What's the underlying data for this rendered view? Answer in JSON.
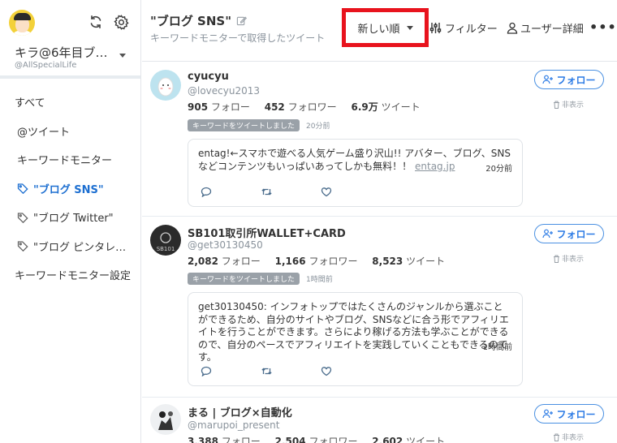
{
  "sidebar": {
    "account_name": "キラ@6年目ブ…",
    "account_handle": "@AllSpecialLife",
    "items": [
      {
        "label": "すべて"
      },
      {
        "label": "@ツイート"
      },
      {
        "label": "キーワードモニター"
      },
      {
        "label": "\"ブログ SNS\""
      },
      {
        "label": "\"ブログ Twitter\""
      },
      {
        "label": "\"ブログ ピンタレ…"
      },
      {
        "label": "キーワードモニター設定"
      }
    ]
  },
  "header": {
    "title": "\"ブログ SNS\"",
    "subtitle": "キーワードモニターで取得したツイート",
    "sort_label": "新しい順",
    "filter_label": "フィルター",
    "user_detail_label": "ユーザー詳細",
    "more_label": "•••"
  },
  "feed": [
    {
      "name": "cyucyu",
      "handle": "@lovecyu2013",
      "following": "905",
      "following_label": "フォロー",
      "followers": "452",
      "followers_label": "フォロワー",
      "tweets": "6.9万",
      "tweets_label": "ツイート",
      "badge": "キーワードをツイートしました",
      "badge_time": "20分前",
      "tweet_text": "entag!←スマホで遊べる人気ゲーム盛り沢山!! アバター、ブログ、SNSなどコンテンツもいっぱいあってしかも無料！！",
      "tweet_link": "entag.jp",
      "tweet_time": "20分前",
      "follow_label": "フォロー",
      "hide_label": "非表示"
    },
    {
      "name": "SB101取引所WALLET+CARD",
      "handle": "@get30130450",
      "following": "2,082",
      "following_label": "フォロー",
      "followers": "1,166",
      "followers_label": "フォロワー",
      "tweets": "8,523",
      "tweets_label": "ツイート",
      "badge": "キーワードをツイートしました",
      "badge_time": "1時間前",
      "tweet_text": "get30130450: インフォトップではたくさんのジャンルから選ぶことができるため、自分のサイトやブログ、SNSなどに合う形でアフィリエイトを行うことができます。さらにより稼げる方法も学ぶことができるので、自分のペースでアフィリエイトを実践していくこともできるのです。",
      "tweet_link": "",
      "tweet_time": "1時間前",
      "follow_label": "フォロー",
      "hide_label": "非表示"
    },
    {
      "name": "まる | ブログ×自動化",
      "handle": "@marupoi_present",
      "following": "3,388",
      "following_label": "フォロー",
      "followers": "2,504",
      "followers_label": "フォロワー",
      "tweets": "2,602",
      "tweets_label": "ツイート",
      "follow_label": "フォロー",
      "hide_label": "非表示"
    }
  ],
  "colors": {
    "accent": "#2c7be5",
    "highlight_box": "#e8131d",
    "badge": "#9aa1a8"
  },
  "icons": {
    "refresh": "refresh-icon",
    "settings": "gear-icon",
    "tag": "tag-icon",
    "edit": "pencil-icon",
    "filter": "sliders-icon",
    "user": "user-icon",
    "reply": "reply-icon",
    "retweet": "retweet-icon",
    "like": "heart-icon",
    "follow": "add-user-icon",
    "hide": "trash-icon"
  }
}
